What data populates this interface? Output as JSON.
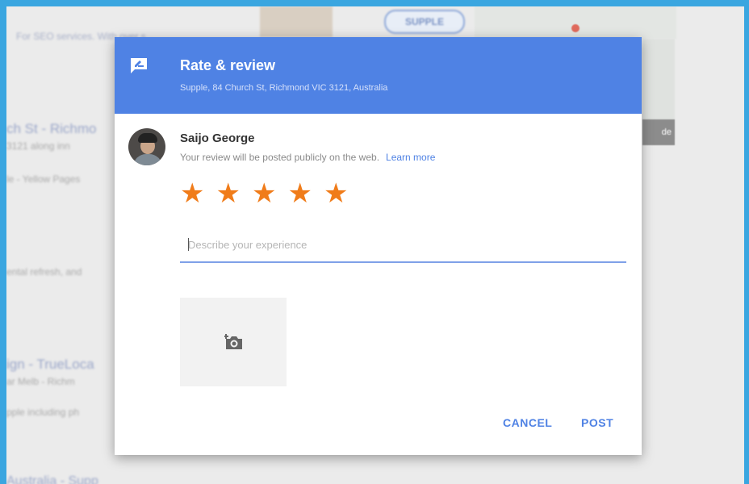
{
  "background": {
    "sign_text": "SUPPLE",
    "map_button": "de",
    "result_lines": [
      "For SEO services. With over s...",
      "ch St - Richmo",
      "3121 along inn",
      "le - Yellow Pages",
      "ental refresh, and",
      "ign - TrueLoca",
      "ar Melb - Richm",
      "pple including ph",
      "Australia - Supp"
    ]
  },
  "dialog": {
    "header": {
      "icon": "rate-review-icon",
      "title": "Rate & review",
      "subtitle": "Supple, 84 Church St, Richmond VIC 3121, Australia"
    },
    "user": {
      "name": "Saijo George",
      "notice": "Your review will be posted publicly on the web.",
      "learn_more": "Learn more"
    },
    "rating": {
      "value": 5,
      "max": 5
    },
    "review": {
      "placeholder": "Describe your experience",
      "value": ""
    },
    "photo": {
      "icon": "add-photo-icon"
    },
    "actions": {
      "cancel": "CANCEL",
      "post": "POST"
    },
    "colors": {
      "header": "#4f82e4",
      "star": "#f07c1a",
      "link": "#4f82e4"
    }
  }
}
